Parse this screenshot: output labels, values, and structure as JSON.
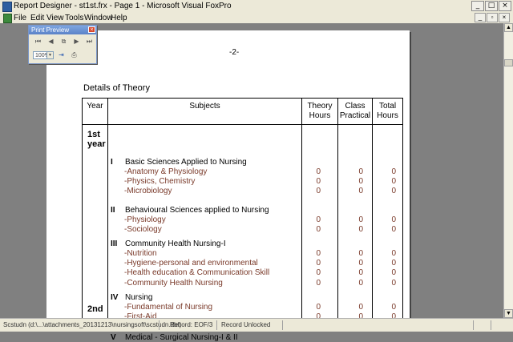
{
  "window": {
    "title": "Report Designer - st1st.frx - Page 1 - Microsoft Visual FoxPro"
  },
  "menu": [
    "File",
    "Edit",
    "View",
    "Tools",
    "Window",
    "Help"
  ],
  "preview_toolbar": {
    "title": "Print Preview",
    "zoom": "100%"
  },
  "report": {
    "page_label": "-2-",
    "heading": "Details of Theory",
    "columns": {
      "year": "Year",
      "subjects": "Subjects",
      "theory": "Theory Hours",
      "class": "Class Practical",
      "total": "Total Hours"
    },
    "years": [
      "1st year",
      "2nd"
    ],
    "sections": [
      {
        "num": "I",
        "title": "Basic Sciences Applied to Nursing",
        "rows": [
          {
            "name": "-Anatomy & Physiology",
            "theory": "0",
            "class": "0",
            "total": "0"
          },
          {
            "name": "-Physics, Chemistry",
            "theory": "0",
            "class": "0",
            "total": "0"
          },
          {
            "name": "-Microbiology",
            "theory": "0",
            "class": "0",
            "total": "0"
          }
        ]
      },
      {
        "num": "II",
        "title": "Behavioural Sciences applied to Nursing",
        "rows": [
          {
            "name": "-Physiology",
            "theory": "0",
            "class": "0",
            "total": "0"
          },
          {
            "name": "-Sociology",
            "theory": "0",
            "class": "0",
            "total": "0"
          }
        ]
      },
      {
        "num": "III",
        "title": "Community Health Nursing-I",
        "rows": [
          {
            "name": "-Nutrition",
            "theory": "0",
            "class": "0",
            "total": "0"
          },
          {
            "name": "-Hygiene-personal and environmental",
            "theory": "0",
            "class": "0",
            "total": "0"
          },
          {
            "name": "-Health education & Communication Skill",
            "theory": "0",
            "class": "0",
            "total": "0"
          },
          {
            "name": "-Community Health Nursing",
            "theory": "0",
            "class": "0",
            "total": "0"
          }
        ]
      },
      {
        "num": "IV",
        "title": "Nursing",
        "rows": [
          {
            "name": "-Fundamental of Nursing",
            "theory": "0",
            "class": "0",
            "total": "0"
          },
          {
            "name": "-First-Aid",
            "theory": "0",
            "class": "0",
            "total": "0"
          }
        ]
      },
      {
        "num": "V",
        "title": "Medical - Surgical Nursing-I & II",
        "rows": []
      }
    ]
  },
  "status": {
    "table": "Scstudn (d:\\...\\attachments_20131213\\nursingsoft\\scstudn.dbf)",
    "record": "Record: EOF/3",
    "lock": "Record Unlocked"
  }
}
